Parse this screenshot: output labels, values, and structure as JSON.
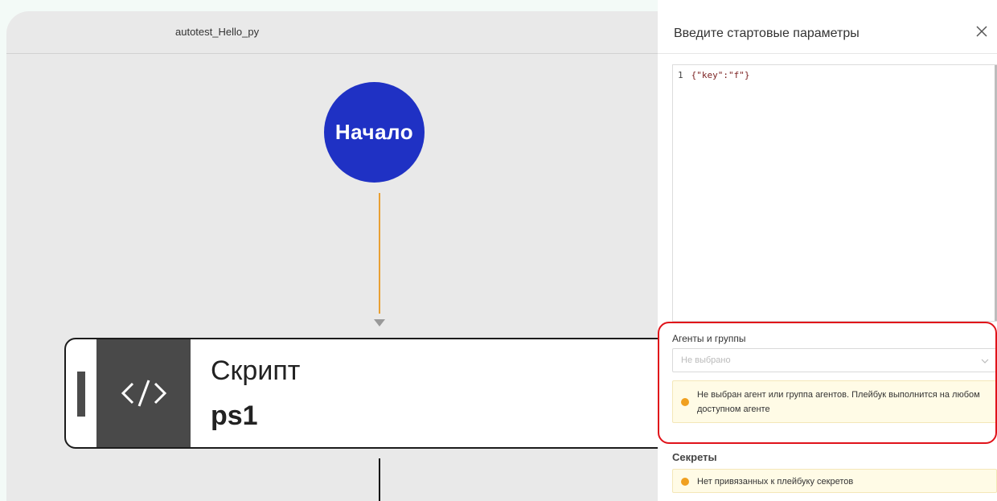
{
  "canvas": {
    "title": "autotest_Hello_py",
    "start_node_label": "Начало",
    "script_node": {
      "type_label": "Скрипт",
      "name": "ps1",
      "icon": "code-icon"
    }
  },
  "panel": {
    "title": "Введите стартовые параметры",
    "close_icon": "close-icon",
    "editor": {
      "line_number": "1",
      "code": "{\"key\":\"f\"}"
    },
    "agents": {
      "label": "Агенты и группы",
      "placeholder": "Не выбрано",
      "warning": "Не выбран агент или группа агентов. Плейбук выполнится на любом доступном агенте"
    },
    "secrets": {
      "label": "Секреты",
      "warning": "Нет привязанных к плейбуку секретов"
    }
  },
  "colors": {
    "start_node": "#1f31c4",
    "edge": "#e8a033",
    "highlight": "#e0131a",
    "warning_bg": "#fffbe6",
    "warning_icon": "#f0a020"
  }
}
